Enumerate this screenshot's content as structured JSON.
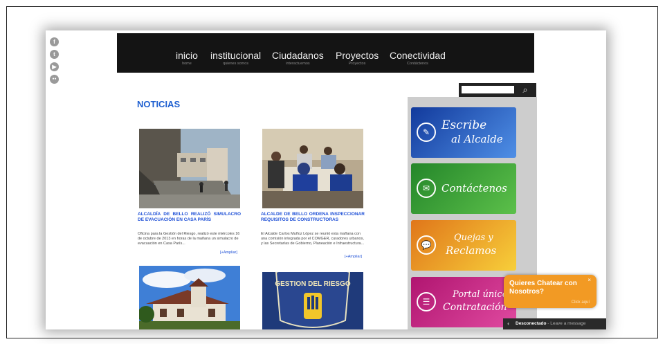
{
  "social": [
    {
      "name": "facebook-icon",
      "glyph": "f"
    },
    {
      "name": "twitter-icon",
      "glyph": "t"
    },
    {
      "name": "youtube-icon",
      "glyph": "▶"
    },
    {
      "name": "flickr-icon",
      "glyph": "●●"
    }
  ],
  "nav": {
    "items": [
      {
        "title": "inicio",
        "sub": "home"
      },
      {
        "title": "institucional",
        "sub": "quienes somos"
      },
      {
        "title": "Ciudadanos",
        "sub": "interactuemos"
      },
      {
        "title": "Proyectos",
        "sub": "Proyectos"
      },
      {
        "title": "Conectividad",
        "sub": "Contáctenos"
      }
    ]
  },
  "search": {
    "placeholder": ""
  },
  "main": {
    "section_title": "NOTICIAS",
    "news": [
      {
        "title": "ALCALDÍA DE BELLO REALIZÓ SIMULACRO DE EVACUACIÓN EN CASA PARÍS",
        "text": "Oficina para la Gestión del Riesgo, realizó este miércoles 16 de octubre de 2013 en horas de la mañana un simulacro de evacuación en Casa París...",
        "more": "[+Ampliar]"
      },
      {
        "title": "ALCALDE DE BELLO ORDENA INSPECCIONAR REQUISITOS DE CONSTRUCTORAS",
        "text": "El Alcalde Carlos Muñoz López se reunió esta mañana con una comisión integrada por el COMGER, curadores urbanos, y las Secretarías de Gobierno, Planeación e Infraestructura...",
        "more": "[+Ampliar]"
      }
    ]
  },
  "sidebar": {
    "banners": [
      {
        "name": "escribe-al-alcalde",
        "line1": "Escribe",
        "line2": "al Alcalde",
        "icon": "✎",
        "color1": "#1a4fc7",
        "color2": "#4f8fe6"
      },
      {
        "name": "contactenos",
        "line1": "Contáctenos",
        "line2": "",
        "icon": "✉",
        "color1": "#2e9c2e",
        "color2": "#5cc04a"
      },
      {
        "name": "quejas-reclamos",
        "line1": "Quejas y",
        "line2": "Reclamos",
        "icon": "💬",
        "color1": "#e8a21a",
        "color2": "#f5c93a"
      },
      {
        "name": "portal-contratacion",
        "line1": "Portal único",
        "line2": "Contratación",
        "icon": "☰",
        "color1": "#c2187a",
        "color2": "#e04aa0"
      }
    ]
  },
  "chat": {
    "title": "Quieres Chatear con Nosotros?",
    "close": "×",
    "click": "Click aquí",
    "status": "Desconectado",
    "status_sub": " - Leave a message"
  }
}
